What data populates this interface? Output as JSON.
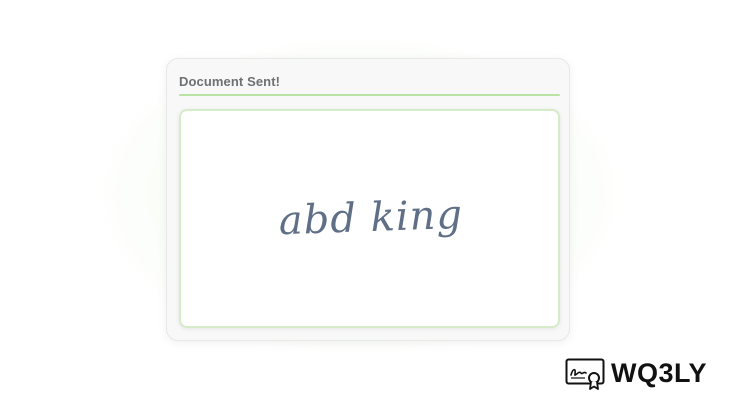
{
  "card": {
    "title": "Document Sent!"
  },
  "signature": {
    "text": "abd king"
  },
  "brand": {
    "name": "WQ3LY",
    "icon": "certificate-signature-icon"
  },
  "colors": {
    "accent": "#b9e3a4",
    "signature_ink": "#5f6f86",
    "title_text": "#6e7073",
    "brand_text": "#111111"
  }
}
